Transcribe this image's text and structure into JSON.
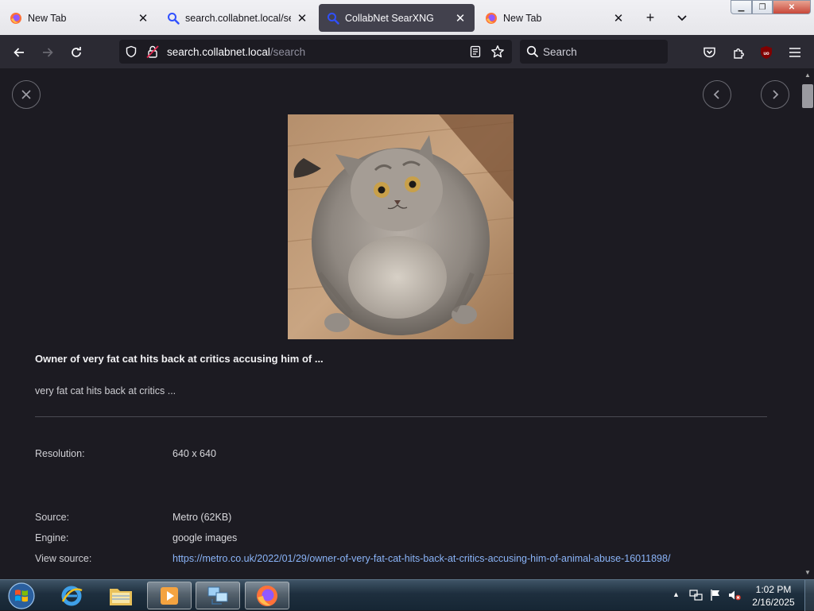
{
  "browser": {
    "tabs": [
      {
        "title": "New Tab",
        "icon": "firefox-icon",
        "active": false
      },
      {
        "title": "search.collabnet.local/sear",
        "icon": "search-icon",
        "active": false
      },
      {
        "title": "CollabNet SearXNG",
        "icon": "search-icon",
        "active": true
      },
      {
        "title": "New Tab",
        "icon": "firefox-icon",
        "active": false
      }
    ],
    "url": {
      "host": "search.collabnet.local",
      "path": "/search"
    },
    "search_placeholder": "Search"
  },
  "detail": {
    "title": "Owner of very fat cat hits back at critics accusing him of ...",
    "description": "very fat cat hits back at critics ...",
    "rows": [
      {
        "label": "Resolution:",
        "value": "640 x 640"
      },
      {
        "label": "Source:",
        "value": "Metro (62KB)"
      },
      {
        "label": "Engine:",
        "value": "google images"
      },
      {
        "label": "View source:",
        "value": "https://metro.co.uk/2022/01/29/owner-of-very-fat-cat-hits-back-at-critics-accusing-him-of-animal-abuse-16011898/"
      }
    ]
  },
  "taskbar": {
    "time": "1:02 PM",
    "date": "2/16/2025"
  },
  "colors": {
    "page_bg": "#1c1b22",
    "toolbar_bg": "#2b2a33",
    "link": "#8ab4f8",
    "active_tab": "#42414d"
  }
}
